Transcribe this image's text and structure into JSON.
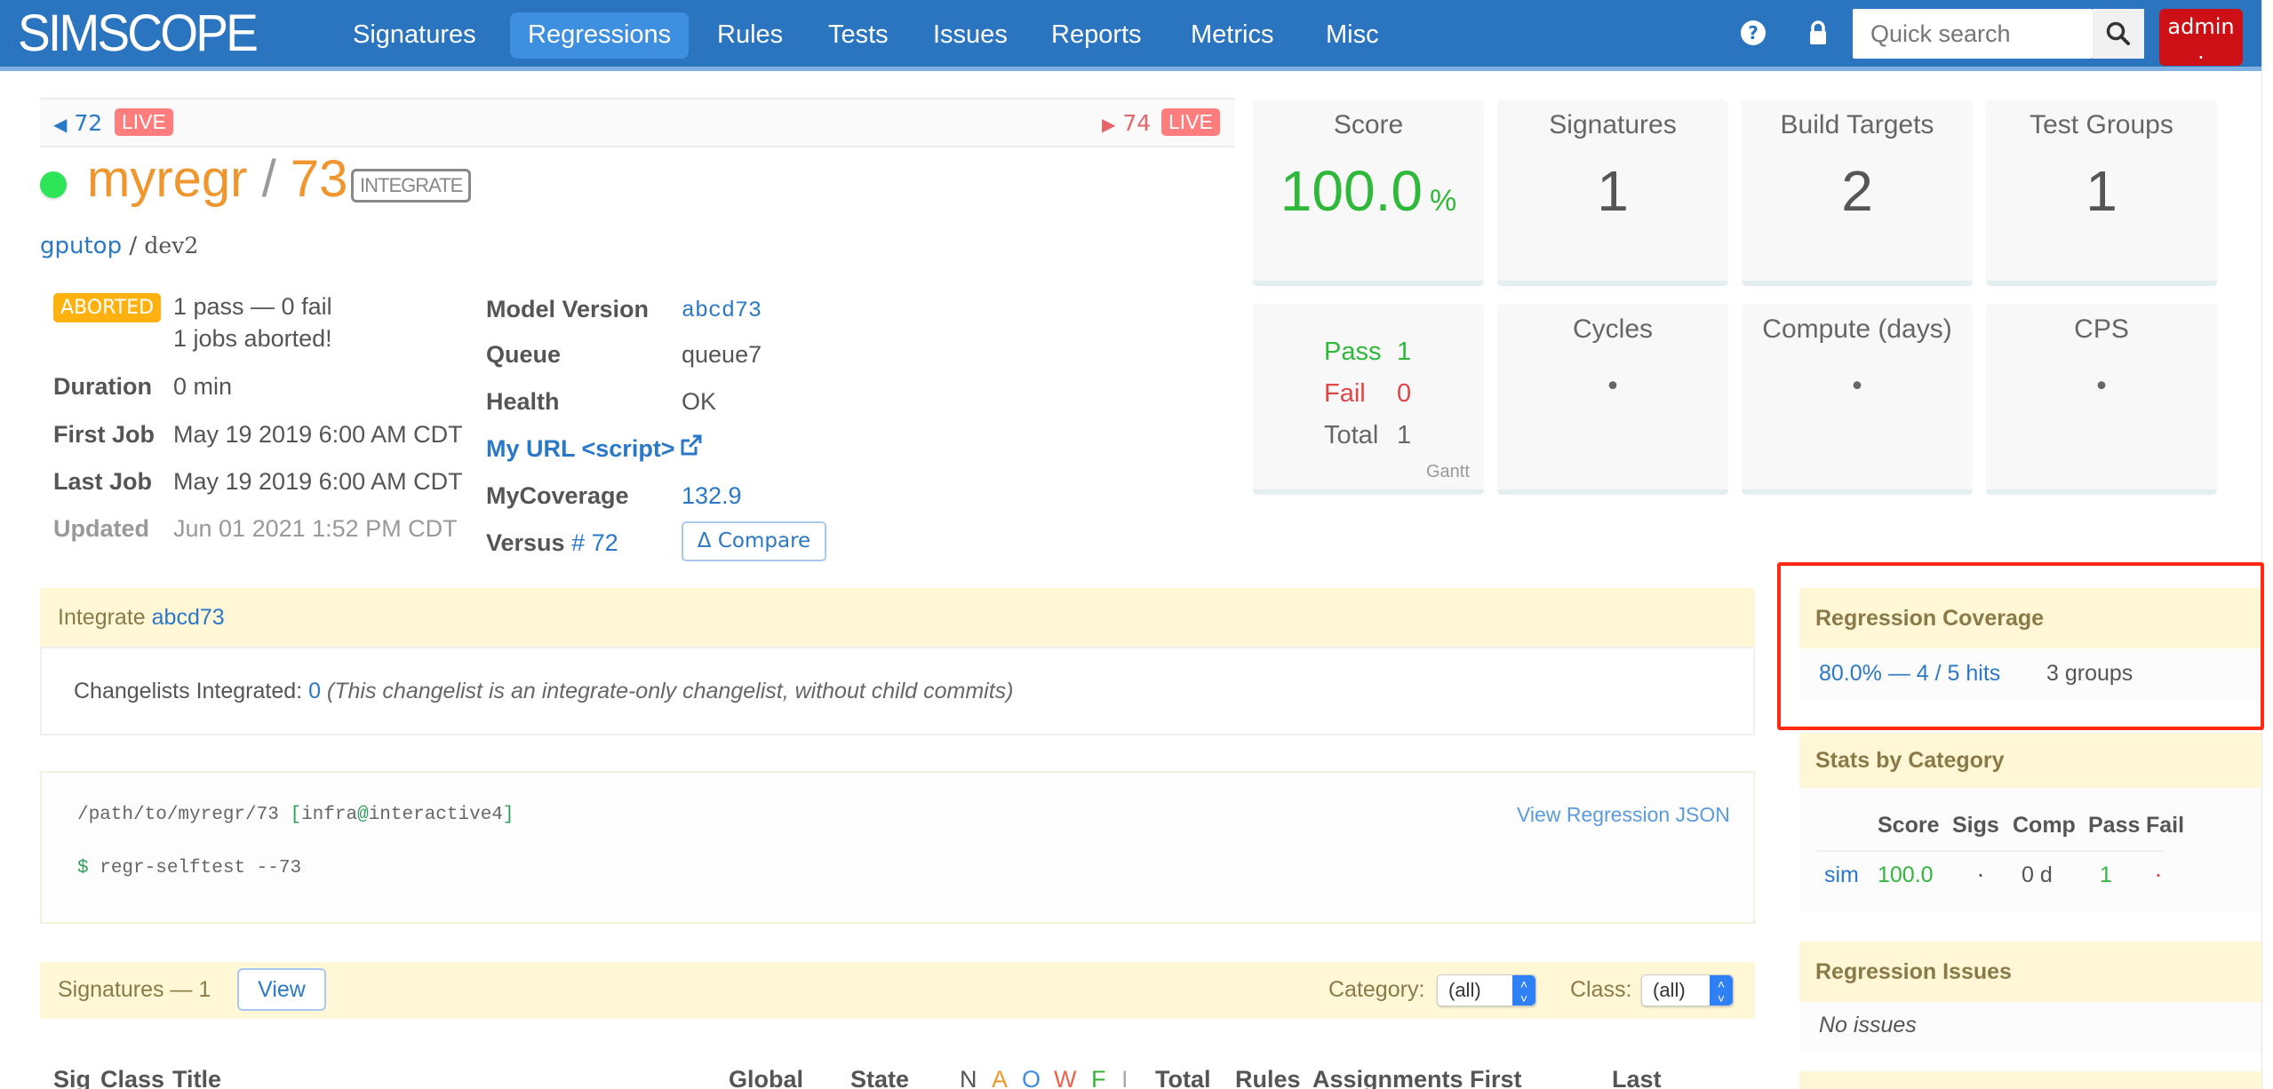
{
  "navbar": {
    "logo": "SIMSCOPE",
    "items": [
      {
        "label": "Signatures",
        "active": false
      },
      {
        "label": "Regressions",
        "active": true
      },
      {
        "label": "Rules",
        "active": false
      },
      {
        "label": "Tests",
        "active": false
      },
      {
        "label": "Issues",
        "active": false
      },
      {
        "label": "Reports",
        "active": false
      },
      {
        "label": "Metrics",
        "active": false
      },
      {
        "label": "Misc",
        "active": false
      }
    ],
    "help_icon": "question-circle-icon",
    "lock_icon": "lock-icon",
    "search": {
      "placeholder": "Quick search",
      "value": ""
    },
    "search_icon": "search-icon",
    "user": {
      "label": "admin",
      "sub": "."
    }
  },
  "prevnext": {
    "prev": {
      "number": "72",
      "badge": "LIVE"
    },
    "next": {
      "number": "74",
      "badge": "LIVE"
    }
  },
  "header": {
    "name": "myregr",
    "separator": "/",
    "number": "73",
    "type_badge": "INTEGRATE",
    "status_color": "#2ee55a",
    "project": "gputop",
    "project_sep": "/",
    "branch": "dev2"
  },
  "details_left": {
    "status_badge": "ABORTED",
    "summary": "1 pass — 0 fail",
    "summary2": "1 jobs aborted!",
    "rows": [
      {
        "label": "Duration",
        "value": "0 min"
      },
      {
        "label": "First Job",
        "value": "May 19 2019 6:00 AM CDT"
      },
      {
        "label": "Last Job",
        "value": "May 19 2019 6:00 AM CDT"
      },
      {
        "label": "Updated",
        "value": "Jun 01 2021 1:52 PM CDT"
      }
    ]
  },
  "details_right": {
    "model_version": {
      "label": "Model Version",
      "value": "abcd73"
    },
    "queue": {
      "label": "Queue",
      "value": "queue7"
    },
    "health": {
      "label": "Health",
      "value": "OK"
    },
    "my_url": {
      "label": "My URL <script>",
      "icon": "external-link-icon"
    },
    "my_coverage": {
      "label": "MyCoverage",
      "value": "132.9"
    },
    "versus": {
      "label": "Versus",
      "value": "# 72",
      "compare_label": "Δ Compare"
    }
  },
  "stats": {
    "score": {
      "title": "Score",
      "value": "100.0",
      "unit": "%"
    },
    "signatures": {
      "title": "Signatures",
      "value": "1"
    },
    "build_targets": {
      "title": "Build Targets",
      "value": "2"
    },
    "test_groups": {
      "title": "Test Groups",
      "value": "1"
    },
    "results": {
      "pass_label": "Pass",
      "pass": "1",
      "fail_label": "Fail",
      "fail": "0",
      "total_label": "Total",
      "total": "1",
      "gantt_link": "Gantt"
    },
    "cycles": {
      "title": "Cycles",
      "value": "•"
    },
    "compute": {
      "title": "Compute (days)",
      "value": "•"
    },
    "cps": {
      "title": "CPS",
      "value": "•"
    }
  },
  "integrate": {
    "title": "Integrate",
    "version": "abcd73",
    "changelists_label": "Changelists Integrated:",
    "changelists_count": "0",
    "note": "(This changelist is an integrate-only changelist, without child commits)"
  },
  "command": {
    "path": "/path/to/myregr/73",
    "user_host_open": "[",
    "user": "infra",
    "at": "@",
    "host": "interactive4",
    "user_host_close": "]",
    "prompt": "$",
    "cmd": "regr-selftest --73",
    "json_link": "View Regression JSON"
  },
  "signatures": {
    "title": "Signatures — 1",
    "view_label": "View",
    "category_label": "Category:",
    "category_value": "(all)",
    "class_label": "Class:",
    "class_value": "(all)",
    "columns": [
      "Sig",
      "Class",
      "Title",
      "Global",
      "State",
      "N",
      "A",
      "O",
      "W",
      "F",
      "I",
      "Total",
      "Rules",
      "Assignments",
      "First",
      "Last"
    ],
    "state_colors": {
      "N": "#555555",
      "A": "#f0962f",
      "O": "#3a8ee6",
      "W": "#f0604d",
      "F": "#3bb33b",
      "I": "#aaaaaa"
    }
  },
  "coverage": {
    "title": "Regression Coverage",
    "hits": "80.0% — 4 / 5 hits",
    "groups": "3 groups"
  },
  "stats_by_category": {
    "title": "Stats by Category",
    "columns": [
      "",
      "Score",
      "Sigs",
      "Comp",
      "Pass",
      "Fail"
    ],
    "rows": [
      {
        "category": "sim",
        "score": "100.0",
        "sigs": "·",
        "comp": "0 d",
        "pass": "1",
        "fail": "·"
      }
    ]
  },
  "issues": {
    "title": "Regression Issues",
    "empty": "No issues"
  }
}
